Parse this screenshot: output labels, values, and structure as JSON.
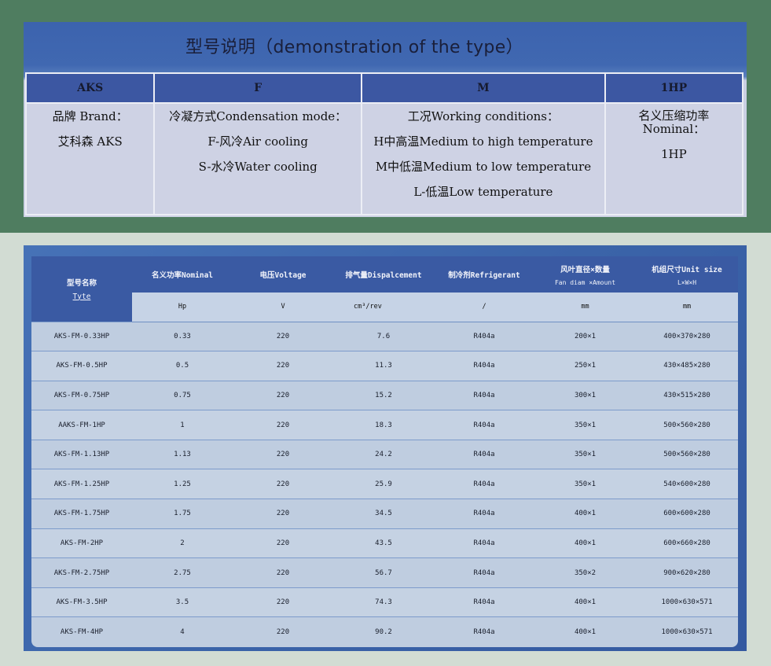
{
  "type_demo": {
    "title": "型号说明（demonstration of the type）",
    "headers": [
      "AKS",
      "F",
      "M",
      "1HP"
    ],
    "col1": [
      "品牌 Brand：",
      "艾科森 AKS"
    ],
    "col2": [
      "冷凝方式Condensation mode：",
      "F-风冷Air cooling",
      "S-水冷Water cooling"
    ],
    "col3": [
      "工况Working conditions：",
      "H中高温Medium to high temperature",
      "M中低温Medium to low temperature",
      "L-低温Low temperature"
    ],
    "col4": [
      "名义压缩功率",
      "Nominal：",
      "1HP"
    ]
  },
  "spec_table": {
    "model_header": "型号名称",
    "model_sub": "Tyte",
    "headers": [
      {
        "main": "名义功率Nominal",
        "sub": ""
      },
      {
        "main": "电压Voltage",
        "sub": ""
      },
      {
        "main": "排气量Dispalcement",
        "sub": ""
      },
      {
        "main": "制冷剂Refrigerant",
        "sub": ""
      },
      {
        "main": "风叶直径×数量",
        "sub": "Fan diam ×Amount"
      },
      {
        "main": "机组尺寸Unit size",
        "sub": "L×W×H"
      }
    ],
    "units": [
      "Hp",
      "V",
      "cm³/rev",
      "/",
      "mm",
      "mm"
    ],
    "rows": [
      [
        "AKS-FM-0.33HP",
        "0.33",
        "220",
        "7.6",
        "R404a",
        "200×1",
        "400×370×280"
      ],
      [
        "AKS-FM-0.5HP",
        "0.5",
        "220",
        "11.3",
        "R404a",
        "250×1",
        "430×485×280"
      ],
      [
        "AKS-FM-0.75HP",
        "0.75",
        "220",
        "15.2",
        "R404a",
        "300×1",
        "430×515×280"
      ],
      [
        "AAKS-FM-1HP",
        "1",
        "220",
        "18.3",
        "R404a",
        "350×1",
        "500×560×280"
      ],
      [
        "AKS-FM-1.13HP",
        "1.13",
        "220",
        "24.2",
        "R404a",
        "350×1",
        "500×560×280"
      ],
      [
        "AKS-FM-1.25HP",
        "1.25",
        "220",
        "25.9",
        "R404a",
        "350×1",
        "540×600×280"
      ],
      [
        "AKS-FM-1.75HP",
        "1.75",
        "220",
        "34.5",
        "R404a",
        "400×1",
        "600×600×280"
      ],
      [
        "AKS-FM-2HP",
        "2",
        "220",
        "43.5",
        "R404a",
        "400×1",
        "600×660×280"
      ],
      [
        "AKS-FM-2.75HP",
        "2.75",
        "220",
        "56.7",
        "R404a",
        "350×2",
        "900×620×280"
      ],
      [
        "AKS-FM-3.5HP",
        "3.5",
        "220",
        "74.3",
        "R404a",
        "400×1",
        "1000×630×571"
      ],
      [
        "AKS-FM-4HP",
        "4",
        "220",
        "90.2",
        "R404a",
        "400×1",
        "1000×630×571"
      ]
    ]
  },
  "colors": {
    "top_band": "#4f7d60",
    "header_blue": "#3c57a2",
    "cell_light": "#ced2e4"
  }
}
